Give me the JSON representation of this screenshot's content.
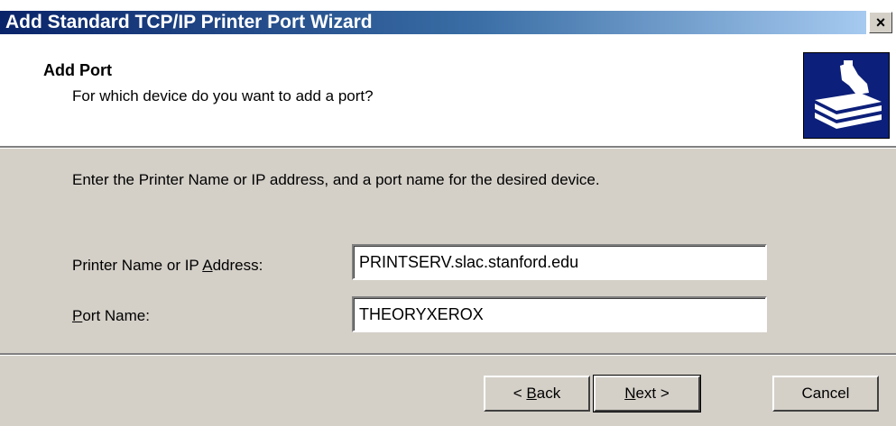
{
  "window": {
    "title": "Add Standard TCP/IP Printer Port Wizard",
    "close_glyph": "×"
  },
  "header": {
    "title": "Add Port",
    "subtitle": "For which device do you want to add a port?",
    "icon": "printer-icon"
  },
  "body": {
    "instruction": "Enter the Printer Name or IP address, and a port name for the desired device.",
    "printer_name_label_pre": "Printer Name or IP ",
    "printer_name_label_access": "A",
    "printer_name_label_post": "ddress:",
    "printer_name_value": "PRINTSERV.slac.stanford.edu",
    "port_name_label_access": "P",
    "port_name_label_post": "ort Name:",
    "port_name_value": "THEORYXEROX"
  },
  "footer": {
    "back_pre": "< ",
    "back_access": "B",
    "back_post": "ack",
    "next_access": "N",
    "next_post": "ext >",
    "cancel": "Cancel"
  },
  "colors": {
    "title_gradient_start": "#0a246a",
    "title_gradient_end": "#a6caf0",
    "dialog_face": "#d4d0c8",
    "icon_bg": "#0c1f7a"
  }
}
